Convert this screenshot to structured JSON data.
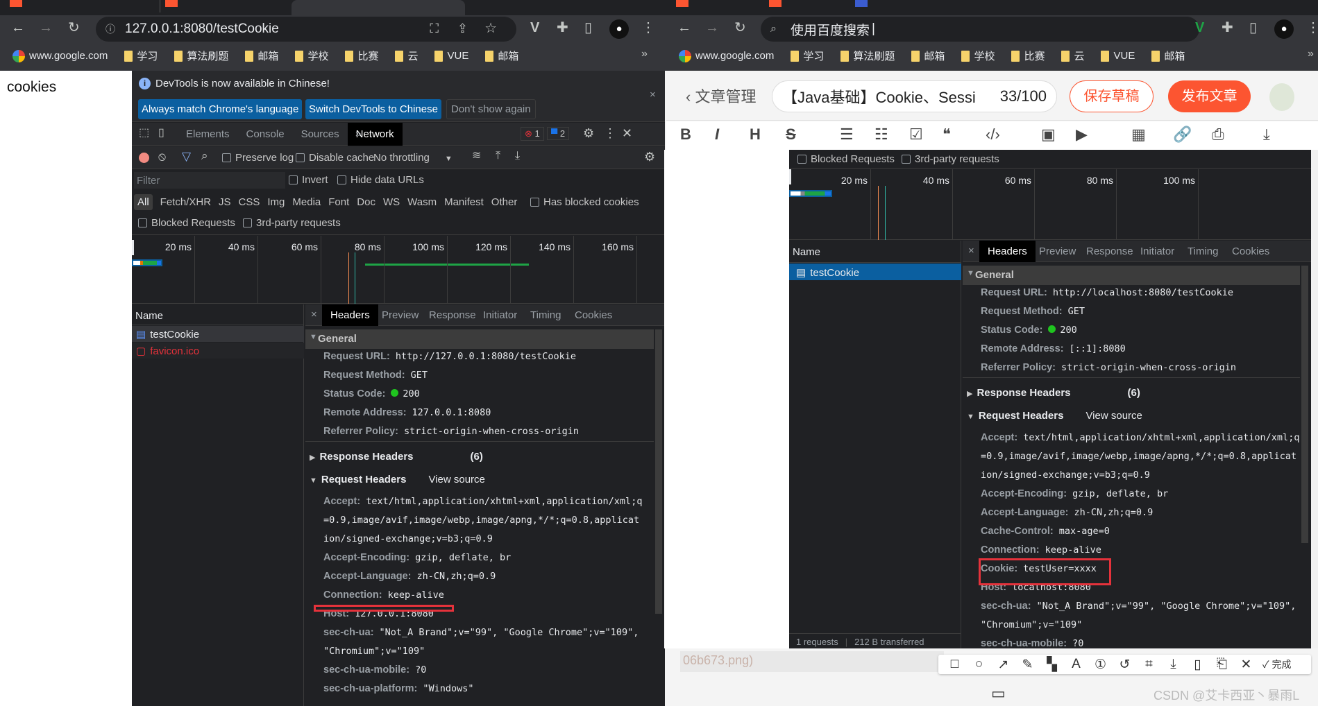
{
  "left_browser": {
    "address": "127.0.0.1:8080/testCookie",
    "bookmarks": [
      "www.google.com",
      "学习",
      "算法刷题",
      "邮箱",
      "学校",
      "比赛",
      "云",
      "VUE",
      "邮箱"
    ],
    "page_text": "cookies",
    "devtools": {
      "banner": {
        "message": "DevTools is now available in Chinese!",
        "btn1": "Always match Chrome's language",
        "btn2": "Switch DevTools to Chinese",
        "btn3": "Don't show again"
      },
      "panel_tabs": [
        "Elements",
        "Console",
        "Sources",
        "Network"
      ],
      "active_panel": "Network",
      "error_count": "1",
      "message_count": "2",
      "toolbar": {
        "preserve_log": "Preserve log",
        "disable_cache": "Disable cache",
        "throttling": "No throttling"
      },
      "filter_placeholder": "Filter",
      "invert": "Invert",
      "hide_data_urls": "Hide data URLs",
      "types": [
        "All",
        "Fetch/XHR",
        "JS",
        "CSS",
        "Img",
        "Media",
        "Font",
        "Doc",
        "WS",
        "Wasm",
        "Manifest",
        "Other"
      ],
      "has_blocked_cookies": "Has blocked cookies",
      "blocked_requests": "Blocked Requests",
      "third_party": "3rd-party requests",
      "timeline_ticks": [
        "20 ms",
        "40 ms",
        "60 ms",
        "80 ms",
        "100 ms",
        "120 ms",
        "140 ms",
        "160 ms"
      ],
      "name_header": "Name",
      "requests": [
        {
          "name": "testCookie",
          "status": "ok"
        },
        {
          "name": "favicon.ico",
          "status": "error"
        }
      ],
      "detail_tabs": [
        "Headers",
        "Preview",
        "Response",
        "Initiator",
        "Timing",
        "Cookies"
      ],
      "general_title": "General",
      "general": [
        {
          "k": "Request URL:",
          "v": "http://127.0.0.1:8080/testCookie"
        },
        {
          "k": "Request Method:",
          "v": "GET"
        },
        {
          "k": "Status Code:",
          "v": "200",
          "dot": true
        },
        {
          "k": "Remote Address:",
          "v": "127.0.0.1:8080"
        },
        {
          "k": "Referrer Policy:",
          "v": "strict-origin-when-cross-origin"
        }
      ],
      "response_headers_title": "Response Headers",
      "response_headers_count": "(6)",
      "request_headers_title": "Request Headers",
      "view_source": "View source",
      "request_headers": [
        {
          "k": "Accept:",
          "v": "text/html,application/xhtml+xml,application/xml;q"
        },
        {
          "k": "",
          "v": "=0.9,image/avif,image/webp,image/apng,*/*;q=0.8,applicat"
        },
        {
          "k": "",
          "v": "ion/signed-exchange;v=b3;q=0.9"
        },
        {
          "k": "Accept-Encoding:",
          "v": "gzip, deflate, br"
        },
        {
          "k": "Accept-Language:",
          "v": "zh-CN,zh;q=0.9"
        },
        {
          "k": "Connection:",
          "v": "keep-alive"
        },
        {
          "k": "Host:",
          "v": "127.0.0.1:8080"
        },
        {
          "k": "sec-ch-ua:",
          "v": "\"Not_A Brand\";v=\"99\", \"Google Chrome\";v=\"109\","
        },
        {
          "k": "",
          "v": "\"Chromium\";v=\"109\""
        },
        {
          "k": "sec-ch-ua-mobile:",
          "v": "?0"
        },
        {
          "k": "sec-ch-ua-platform:",
          "v": "\"Windows\""
        }
      ]
    }
  },
  "right_browser": {
    "address": "使用百度搜索",
    "bookmarks": [
      "www.google.com",
      "学习",
      "算法刷题",
      "邮箱",
      "学校",
      "比赛",
      "云",
      "VUE",
      "邮箱"
    ],
    "editor": {
      "back_label": "文章管理",
      "title_value": "【Java基础】Cookie、Sessi",
      "title_count": "33/100",
      "save_draft": "保存草稿",
      "publish": "发布文章",
      "toolbar_icons": [
        "bold-icon",
        "italic-icon",
        "heading-icon",
        "strikethrough-icon",
        "bullet-list-icon",
        "ordered-list-icon",
        "task-list-icon",
        "quote-icon",
        "code-icon",
        "image-icon",
        "video-icon",
        "table-icon",
        "link-icon",
        "stamp-icon",
        "download-icon"
      ],
      "toolbar_glyphs": [
        "B",
        "I",
        "H",
        "S",
        "☰",
        "☷",
        "☑",
        "❝",
        "‹/›",
        "▣",
        "▶",
        "▦",
        "🔗",
        "⎙",
        "⤓"
      ],
      "partial_text": "06b673.png)"
    },
    "devtools": {
      "blocked_requests": "Blocked Requests",
      "third_party": "3rd-party requests",
      "timeline_ticks": [
        "20 ms",
        "40 ms",
        "60 ms",
        "80 ms",
        "100 ms"
      ],
      "name_header": "Name",
      "requests": [
        {
          "name": "testCookie",
          "selected": true
        }
      ],
      "detail_tabs": [
        "Headers",
        "Preview",
        "Response",
        "Initiator",
        "Timing",
        "Cookies"
      ],
      "general_title": "General",
      "general": [
        {
          "k": "Request URL:",
          "v": "http://localhost:8080/testCookie"
        },
        {
          "k": "Request Method:",
          "v": "GET"
        },
        {
          "k": "Status Code:",
          "v": "200",
          "dot": true
        },
        {
          "k": "Remote Address:",
          "v": "[::1]:8080"
        },
        {
          "k": "Referrer Policy:",
          "v": "strict-origin-when-cross-origin"
        }
      ],
      "response_headers_title": "Response Headers",
      "response_headers_count": "(6)",
      "request_headers_title": "Request Headers",
      "view_source": "View source",
      "request_headers": [
        {
          "k": "Accept:",
          "v": "text/html,application/xhtml+xml,application/xml;q"
        },
        {
          "k": "",
          "v": "=0.9,image/avif,image/webp,image/apng,*/*;q=0.8,applicat"
        },
        {
          "k": "",
          "v": "ion/signed-exchange;v=b3;q=0.9"
        },
        {
          "k": "Accept-Encoding:",
          "v": "gzip, deflate, br"
        },
        {
          "k": "Accept-Language:",
          "v": "zh-CN,zh;q=0.9"
        },
        {
          "k": "Cache-Control:",
          "v": "max-age=0"
        },
        {
          "k": "Connection:",
          "v": "keep-alive"
        },
        {
          "k": "Cookie:",
          "v": "testUser=xxxx"
        },
        {
          "k": "Host:",
          "v": "localhost:8080"
        },
        {
          "k": "sec-ch-ua:",
          "v": "\"Not_A Brand\";v=\"99\", \"Google Chrome\";v=\"109\","
        },
        {
          "k": "",
          "v": "\"Chromium\";v=\"109\""
        },
        {
          "k": "sec-ch-ua-mobile:",
          "v": "?0"
        }
      ],
      "footer": [
        "1 requests",
        "212 B transferred"
      ]
    },
    "screenshot_toolbar": {
      "icons": [
        "rectangle-icon",
        "circle-icon",
        "arrow-icon",
        "pen-icon",
        "mosaic-icon",
        "text-icon",
        "number-icon",
        "undo-icon",
        "ocr-icon",
        "download-icon",
        "pin-icon",
        "bookmark-icon",
        "close-icon"
      ],
      "glyphs": [
        "□",
        "○",
        "↗",
        "✎",
        "▚",
        "A",
        "①",
        "↺",
        "⌗",
        "⤓",
        "▯",
        "⎗",
        "✕"
      ],
      "done": "完成"
    },
    "watermark": "CSDN @艾卡西亚丶暴雨L"
  },
  "colors": {
    "accent": "#1a73e8",
    "csdn_red": "#fc5531",
    "selected_row": "#0b5fa0",
    "highlight_box": "#e5323b",
    "status_ok": "#1fc41f"
  }
}
